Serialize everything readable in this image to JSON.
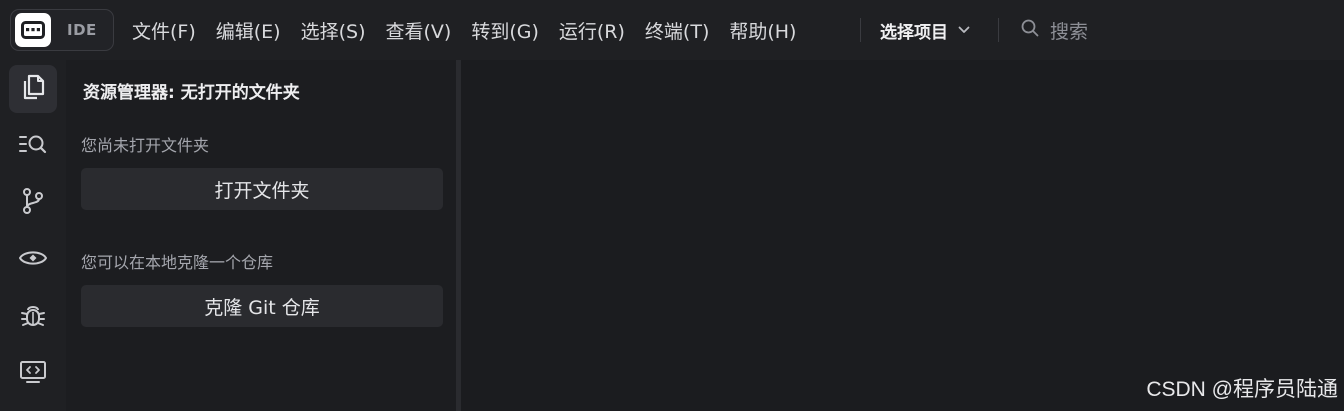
{
  "header": {
    "logo_label": "IDE",
    "menu": [
      {
        "label": "文件(F)"
      },
      {
        "label": "编辑(E)"
      },
      {
        "label": "选择(S)"
      },
      {
        "label": "查看(V)"
      },
      {
        "label": "转到(G)"
      },
      {
        "label": "运行(R)"
      },
      {
        "label": "终端(T)"
      },
      {
        "label": "帮助(H)"
      }
    ],
    "project_select": "选择项目",
    "search_placeholder": "搜索"
  },
  "activity_bar": {
    "items": [
      {
        "icon": "files-icon",
        "active": true
      },
      {
        "icon": "search-list-icon",
        "active": false
      },
      {
        "icon": "source-control-icon",
        "active": false
      },
      {
        "icon": "eye-icon",
        "active": false
      },
      {
        "icon": "bug-icon",
        "active": false
      },
      {
        "icon": "remote-display-icon",
        "active": false
      }
    ]
  },
  "sidebar": {
    "title": "资源管理器: 无打开的文件夹",
    "no_folder_text": "您尚未打开文件夹",
    "open_folder_button": "打开文件夹",
    "clone_text": "您可以在本地克隆一个仓库",
    "clone_button": "克隆 Git 仓库"
  },
  "watermark": "CSDN @程序员陆通",
  "colors": {
    "background": "#1b1c1f",
    "topbar": "#1f2023",
    "button": "#2a2b2f",
    "active_item": "#2e2f34",
    "text": "#d8d9dc"
  }
}
